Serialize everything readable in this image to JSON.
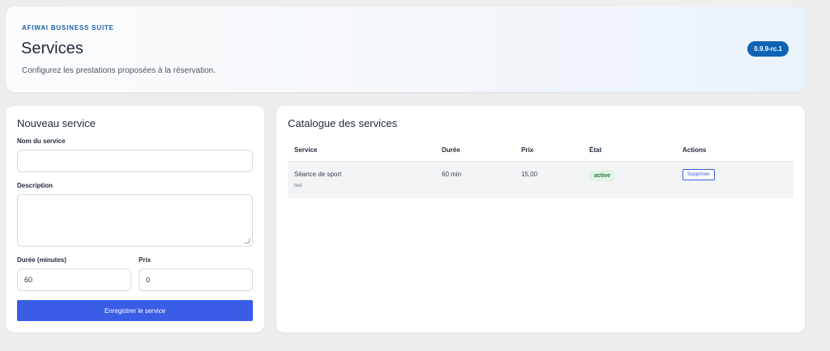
{
  "header": {
    "brand": "AFIWAI BUSINESS SUITE",
    "title": "Services",
    "subtitle": "Configurez les prestations proposées à la réservation.",
    "version": "0.9.9-rc.1"
  },
  "form": {
    "title": "Nouveau service",
    "name_label": "Nom du service",
    "name_value": "",
    "description_label": "Description",
    "description_value": "",
    "duration_label": "Durée (minutes)",
    "duration_value": "60",
    "price_label": "Prix",
    "price_value": "0",
    "submit_label": "Enregistrer le service"
  },
  "catalog": {
    "title": "Catalogue des services",
    "columns": [
      "Service",
      "Durée",
      "Prix",
      "État",
      "Actions"
    ],
    "rows": [
      {
        "name": "Séance de sport",
        "description": "test",
        "duration": "60 min",
        "price": "15,00",
        "status": "active",
        "action": "Supprimer"
      }
    ]
  },
  "colors": {
    "accent": "#3b5ce6",
    "brand": "#1e5fa8",
    "badge": "#0d64b5",
    "status_active_bg": "#e1f4e6",
    "status_active_text": "#1e7a3a"
  }
}
